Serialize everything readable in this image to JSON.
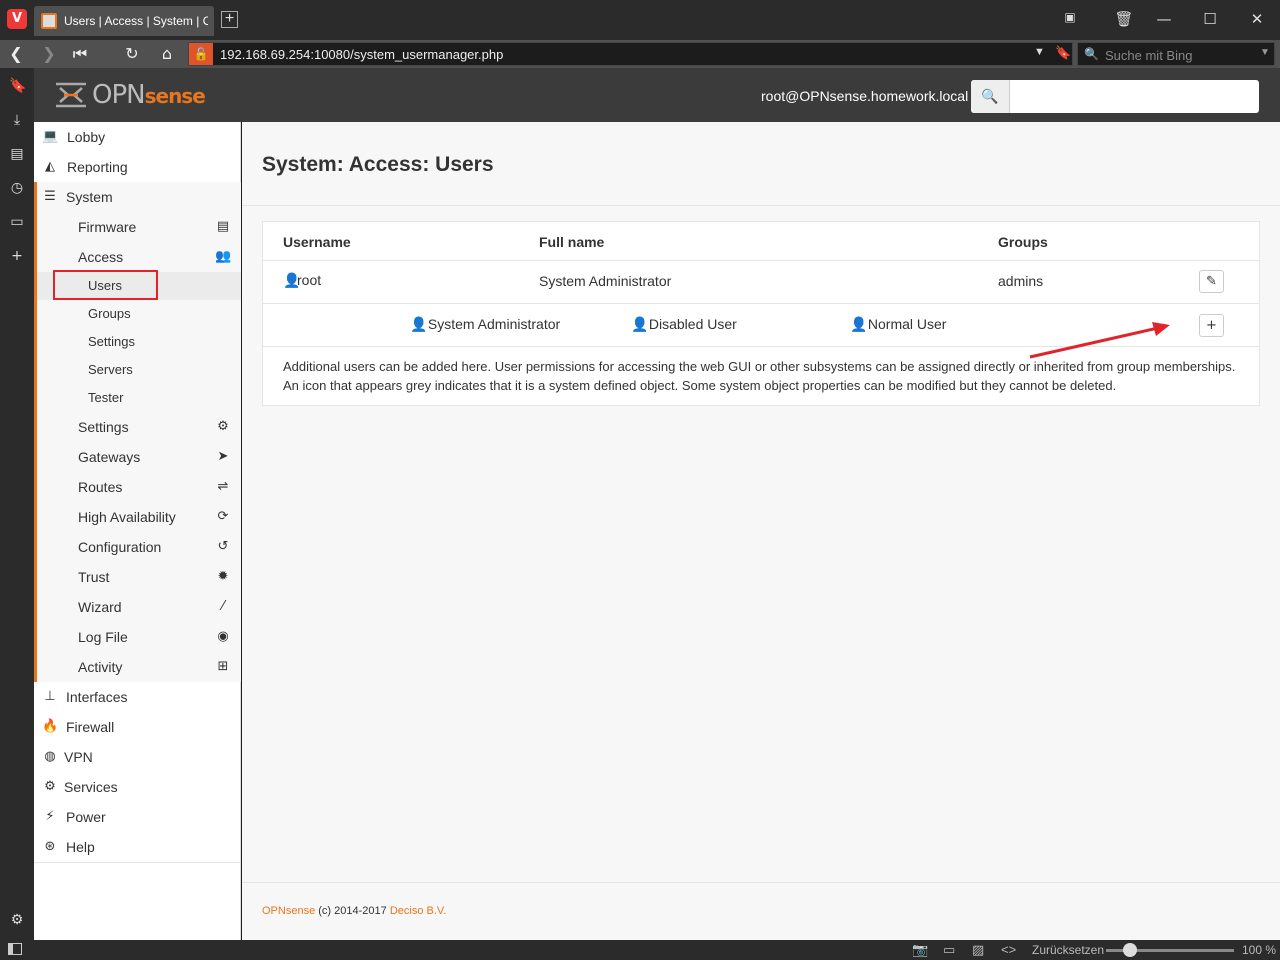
{
  "browser": {
    "tab_title": "Users | Access | System | OPNsense",
    "url": "192.168.69.254:10080/system_usermanager.php",
    "search_placeholder": "Suche mit Bing",
    "status": {
      "reset_label": "Zurücksetzen",
      "zoom": "100 %"
    }
  },
  "header": {
    "logo_text_a": "OPN",
    "logo_text_b": "sense",
    "user": "root@OPNsense.homework.local",
    "search_placeholder": ""
  },
  "sidebar": {
    "lobby": "Lobby",
    "reporting": "Reporting",
    "system": "System",
    "firmware": "Firmware",
    "access": "Access",
    "users": "Users",
    "groups": "Groups",
    "access_settings": "Settings",
    "servers": "Servers",
    "tester": "Tester",
    "settings": "Settings",
    "gateways": "Gateways",
    "routes": "Routes",
    "high_availability": "High Availability",
    "configuration": "Configuration",
    "trust": "Trust",
    "wizard": "Wizard",
    "log_file": "Log File",
    "activity": "Activity",
    "interfaces": "Interfaces",
    "firewall": "Firewall",
    "vpn": "VPN",
    "services": "Services",
    "power": "Power",
    "help": "Help"
  },
  "main": {
    "title": "System: Access: Users",
    "columns": {
      "username": "Username",
      "fullname": "Full name",
      "groups": "Groups"
    },
    "rows": [
      {
        "username": "root",
        "fullname": "System Administrator",
        "groups": "admins"
      }
    ],
    "legend": {
      "admin": "System Administrator",
      "disabled": "Disabled User",
      "normal": "Normal User"
    },
    "description_1": "Additional users can be added here. User permissions for accessing the web GUI or other subsystems can be assigned directly or inherited from group memberships.",
    "description_2": "An icon that appears grey indicates that it is a system defined object. Some system object properties can be modified but they cannot be deleted."
  },
  "footer": {
    "brand": "OPNsense",
    "copy": "(c) 2014-2017",
    "company": "Deciso B.V."
  },
  "colors": {
    "accent": "#e8761e",
    "admin_icon": "#d9534f",
    "disabled_icon": "#777777",
    "normal_icon": "#3f6e9a",
    "highlight": "#e0242a"
  }
}
